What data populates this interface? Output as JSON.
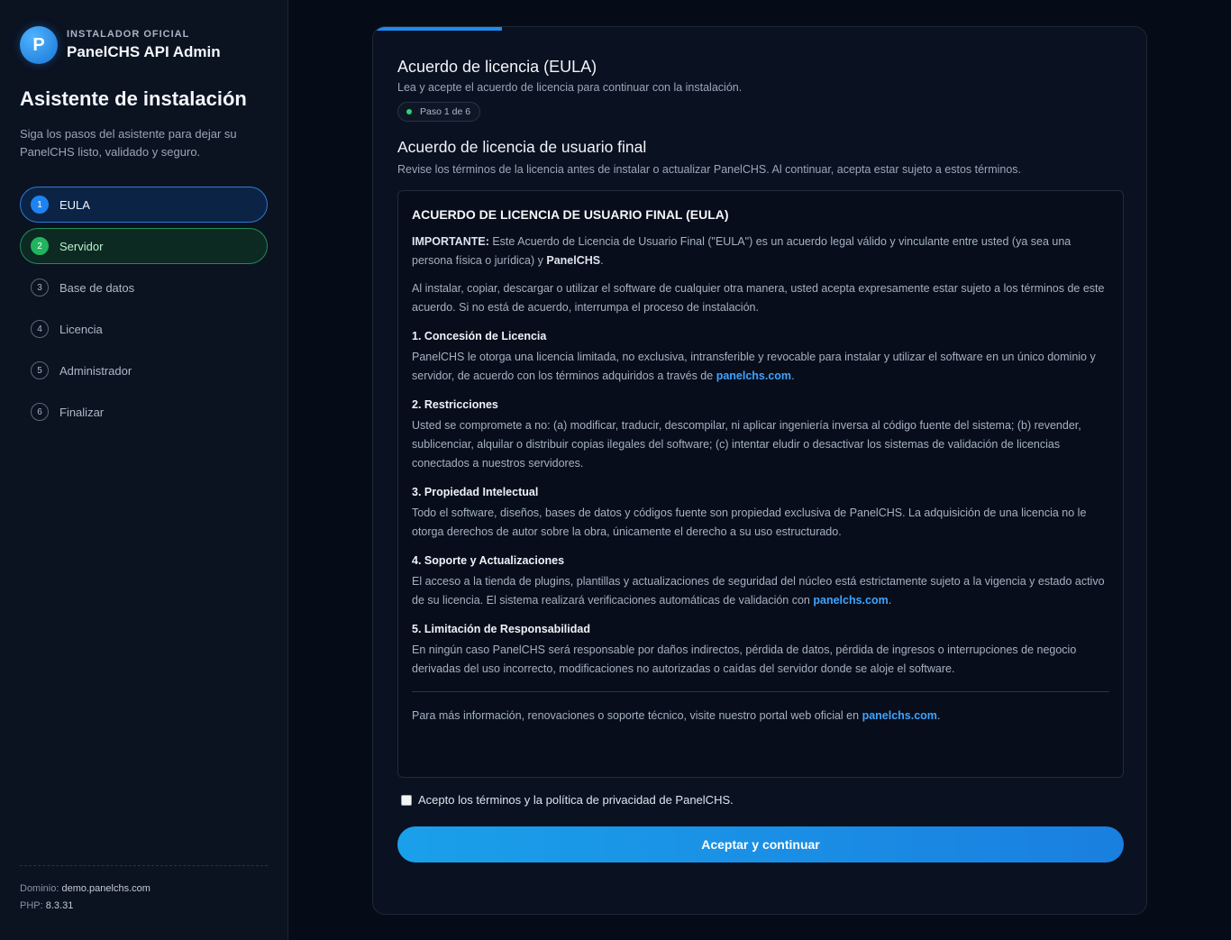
{
  "brand": {
    "kicker": "INSTALADOR OFICIAL",
    "name": "PanelCHS API Admin",
    "logo_letter": "P"
  },
  "sidebar": {
    "title": "Asistente de instalación",
    "description": "Siga los pasos del asistente para dejar su PanelCHS listo, validado y seguro.",
    "steps": [
      {
        "num": "1",
        "label": "EULA",
        "state": "active"
      },
      {
        "num": "2",
        "label": "Servidor",
        "state": "done"
      },
      {
        "num": "3",
        "label": "Base de datos",
        "state": "pending"
      },
      {
        "num": "4",
        "label": "Licencia",
        "state": "pending"
      },
      {
        "num": "5",
        "label": "Administrador",
        "state": "pending"
      },
      {
        "num": "6",
        "label": "Finalizar",
        "state": "pending"
      }
    ],
    "meta": {
      "domain_label": "Dominio:",
      "domain_value": "demo.panelchs.com",
      "php_label": "PHP:",
      "php_value": "8.3.31"
    }
  },
  "card": {
    "title": "Acuerdo de licencia (EULA)",
    "subtitle": "Lea y acepte el acuerdo de licencia para continuar con la instalación.",
    "step_pill": "Paso 1 de 6",
    "progress_fraction": 0.1667,
    "eula_heading": "Acuerdo de licencia de usuario final",
    "eula_sub": "Revise los términos de la licencia antes de instalar o actualizar PanelCHS. Al continuar, acepta estar sujeto a estos términos.",
    "eula": {
      "title": "ACUERDO DE LICENCIA DE USUARIO FINAL (EULA)",
      "important_label": "IMPORTANTE:",
      "important_text": " Este Acuerdo de Licencia de Usuario Final (\"EULA\") es un acuerdo legal válido y vinculante entre usted (ya sea una persona física o jurídica) y ",
      "important_brand": "PanelCHS",
      "intro": "Al instalar, copiar, descargar o utilizar el software de cualquier otra manera, usted acepta expresamente estar sujeto a los términos de este acuerdo. Si no está de acuerdo, interrumpa el proceso de instalación.",
      "s1_title": "1. Concesión de Licencia",
      "s1_text": "PanelCHS le otorga una licencia limitada, no exclusiva, intransferible y revocable para instalar y utilizar el software en un único dominio y servidor, de acuerdo con los términos adquiridos a través de ",
      "s2_title": "2. Restricciones",
      "s2_text": "Usted se compromete a no: (a) modificar, traducir, descompilar, ni aplicar ingeniería inversa al código fuente del sistema; (b) revender, sublicenciar, alquilar o distribuir copias ilegales del software; (c) intentar eludir o desactivar los sistemas de validación de licencias conectados a nuestros servidores.",
      "s3_title": "3. Propiedad Intelectual",
      "s3_text": "Todo el software, diseños, bases de datos y códigos fuente son propiedad exclusiva de PanelCHS. La adquisición de una licencia no le otorga derechos de autor sobre la obra, únicamente el derecho a su uso estructurado.",
      "s4_title": "4. Soporte y Actualizaciones",
      "s4_text": "El acceso a la tienda de plugins, plantillas y actualizaciones de seguridad del núcleo está estrictamente sujeto a la vigencia y estado activo de su licencia. El sistema realizará verificaciones automáticas de validación con ",
      "s5_title": "5. Limitación de Responsabilidad",
      "s5_text": "En ningún caso PanelCHS será responsable por daños indirectos, pérdida de datos, pérdida de ingresos o interrupciones de negocio derivadas del uso incorrecto, modificaciones no autorizadas o caídas del servidor donde se aloje el software.",
      "footer_text": "Para más información, renovaciones o soporte técnico, visite nuestro portal web oficial en ",
      "link": "panelchs.com",
      "period": "."
    },
    "accept_label": "Acepto los términos y la política de privacidad de PanelCHS.",
    "accept_checked": false,
    "button_label": "Aceptar y continuar"
  },
  "colors": {
    "accent": "#1e8bf0",
    "success": "#22b35f",
    "background": "#050b17"
  }
}
